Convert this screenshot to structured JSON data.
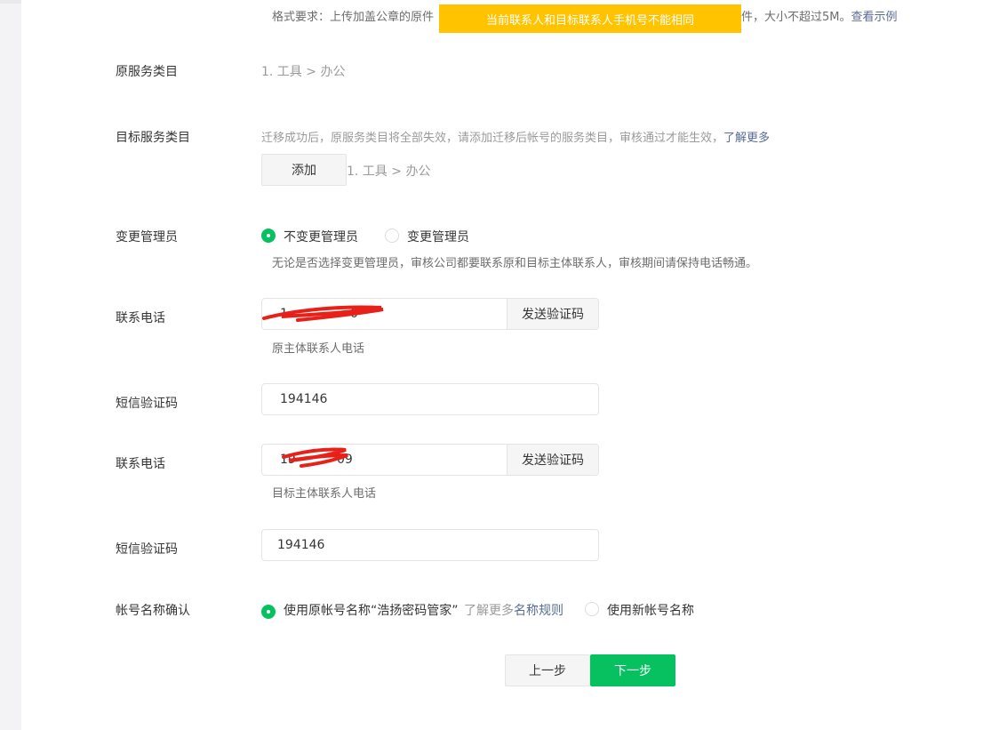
{
  "toast": {
    "text": "当前联系人和目标联系人手机号不能相同"
  },
  "format_req": {
    "prefix": "格式要求：上传加盖公章的原件",
    "suffix": "件，大小不超过5M。",
    "link": "查看示例"
  },
  "original_category": {
    "label": "原服务类目",
    "value": "1. 工具 > 办公"
  },
  "target_category": {
    "label": "目标服务类目",
    "hint": "迁移成功后，原服务类目将全部失效，请添加迁移后帐号的服务类目，审核通过才能生效，",
    "link": "了解更多",
    "add_button": "添加",
    "value": "1. 工具 > 办公"
  },
  "admin_change": {
    "label": "变更管理员",
    "option_keep": "不变更管理员",
    "option_change": "变更管理员",
    "selected": "option_keep",
    "hint": "无论是否选择变更管理员，审核公司都要联系原和目标主体联系人，审核期间请保持电话畅通。"
  },
  "phone_original": {
    "label": "联系电话",
    "value": "1",
    "visible_tail": "0",
    "send_button": "发送验证码",
    "hint": "原主体联系人电话"
  },
  "sms_original": {
    "label": "短信验证码",
    "value": "194146"
  },
  "phone_target": {
    "label": "联系电话",
    "value": "19",
    "visible_tail": "09",
    "send_button": "发送验证码",
    "hint": "目标主体联系人电话"
  },
  "sms_target": {
    "label": "短信验证码",
    "value": "194146"
  },
  "account_name": {
    "label": "帐号名称确认",
    "option_original": "使用原帐号名称“浩扬密码管家”",
    "link_prefix": "了解更多",
    "link": "名称规则",
    "option_new": "使用新帐号名称",
    "selected": "option_original"
  },
  "footer": {
    "prev_button": "上一步",
    "next_button": "下一步"
  },
  "colors": {
    "primary": "#07c160",
    "toast": "#ffc300",
    "link": "#576b95",
    "redaction": "#e8201a"
  }
}
